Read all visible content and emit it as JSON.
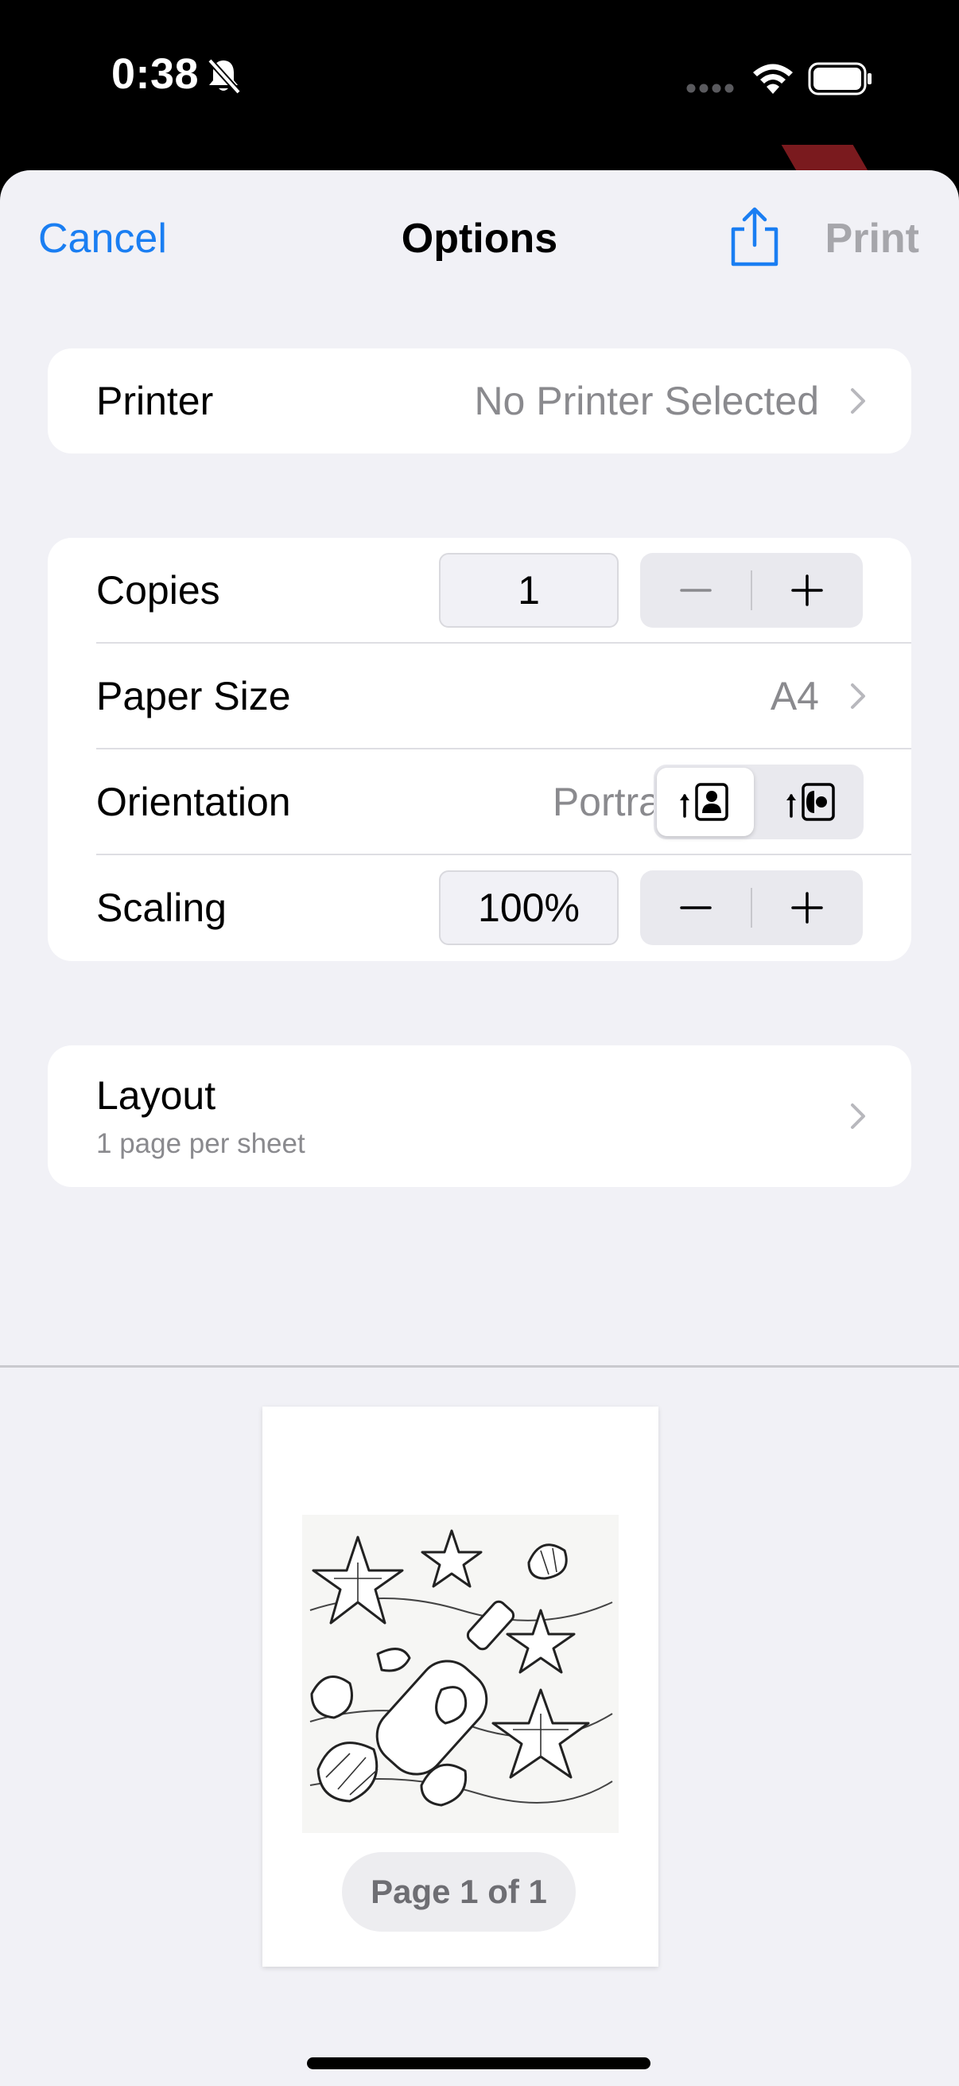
{
  "status_bar": {
    "time": "0:38",
    "icons": [
      "bell-slash-icon",
      "more-dots-icon",
      "wifi-icon",
      "battery-icon"
    ]
  },
  "nav": {
    "cancel_label": "Cancel",
    "title": "Options",
    "share_icon": "share-icon",
    "print_label": "Print"
  },
  "printer": {
    "label": "Printer",
    "value": "No Printer Selected"
  },
  "copies": {
    "label": "Copies",
    "value": "1"
  },
  "paper_size": {
    "label": "Paper Size",
    "value": "A4"
  },
  "orientation": {
    "label": "Orientation",
    "value": "Portrait",
    "options": [
      "portrait-icon",
      "landscape-icon"
    ],
    "selected": "portrait-icon"
  },
  "scaling": {
    "label": "Scaling",
    "value": "100%"
  },
  "layout": {
    "label": "Layout",
    "value": "1 page per sheet"
  },
  "preview": {
    "page_indicator": "Page 1 of 1",
    "artwork": "seashells-starfish-bottle-coloring-page"
  },
  "colors": {
    "accent": "#1a7ef2",
    "background": "#f1f1f6",
    "card": "#ffffff",
    "secondary_text": "#8a8a8e",
    "disabled": "#a6a6ab"
  }
}
